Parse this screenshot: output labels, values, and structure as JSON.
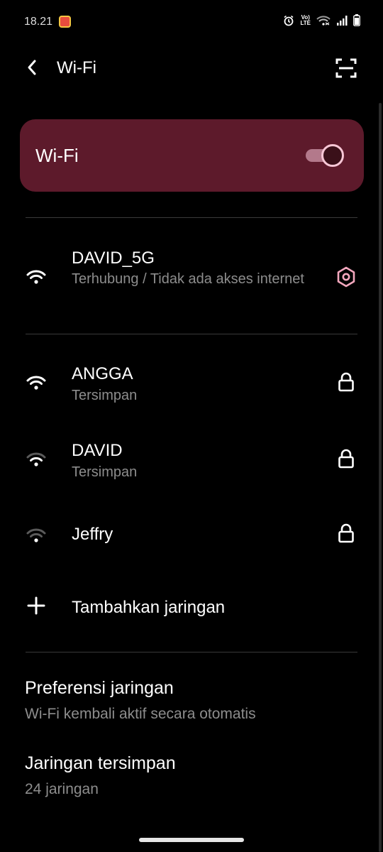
{
  "status_bar": {
    "time": "18.21",
    "volte_top": "Vo)",
    "volte_bottom": "LTE",
    "icons": [
      "app-notification-icon",
      "alarm-icon",
      "volte-icon",
      "wifi-signal-icon",
      "cell-signal-icon",
      "battery-icon"
    ]
  },
  "app_bar": {
    "title": "Wi-Fi",
    "back_icon": "back-arrow-icon",
    "qr_icon": "qr-scan-icon"
  },
  "wifi_toggle": {
    "label": "Wi-Fi",
    "enabled": true,
    "accent_color": "#5d1a2b"
  },
  "connected_network": {
    "name": "DAVID_5G",
    "status": "Terhubung / Tidak ada akses internet",
    "action_icon": "settings-gear-icon"
  },
  "networks": [
    {
      "name": "ANGGA",
      "status": "Tersimpan",
      "signal": "full",
      "action_icon": "lock-icon"
    },
    {
      "name": "DAVID",
      "status": "Tersimpan",
      "signal": "medium",
      "action_icon": "lock-icon"
    },
    {
      "name": "Jeffry",
      "status": "",
      "signal": "low",
      "action_icon": "lock-icon"
    }
  ],
  "add_network": {
    "label": "Tambahkan jaringan",
    "icon": "plus-icon"
  },
  "preferences": [
    {
      "title": "Preferensi jaringan",
      "subtitle": "Wi-Fi kembali aktif secara otomatis"
    },
    {
      "title": "Jaringan tersimpan",
      "subtitle": "24 jaringan"
    }
  ]
}
